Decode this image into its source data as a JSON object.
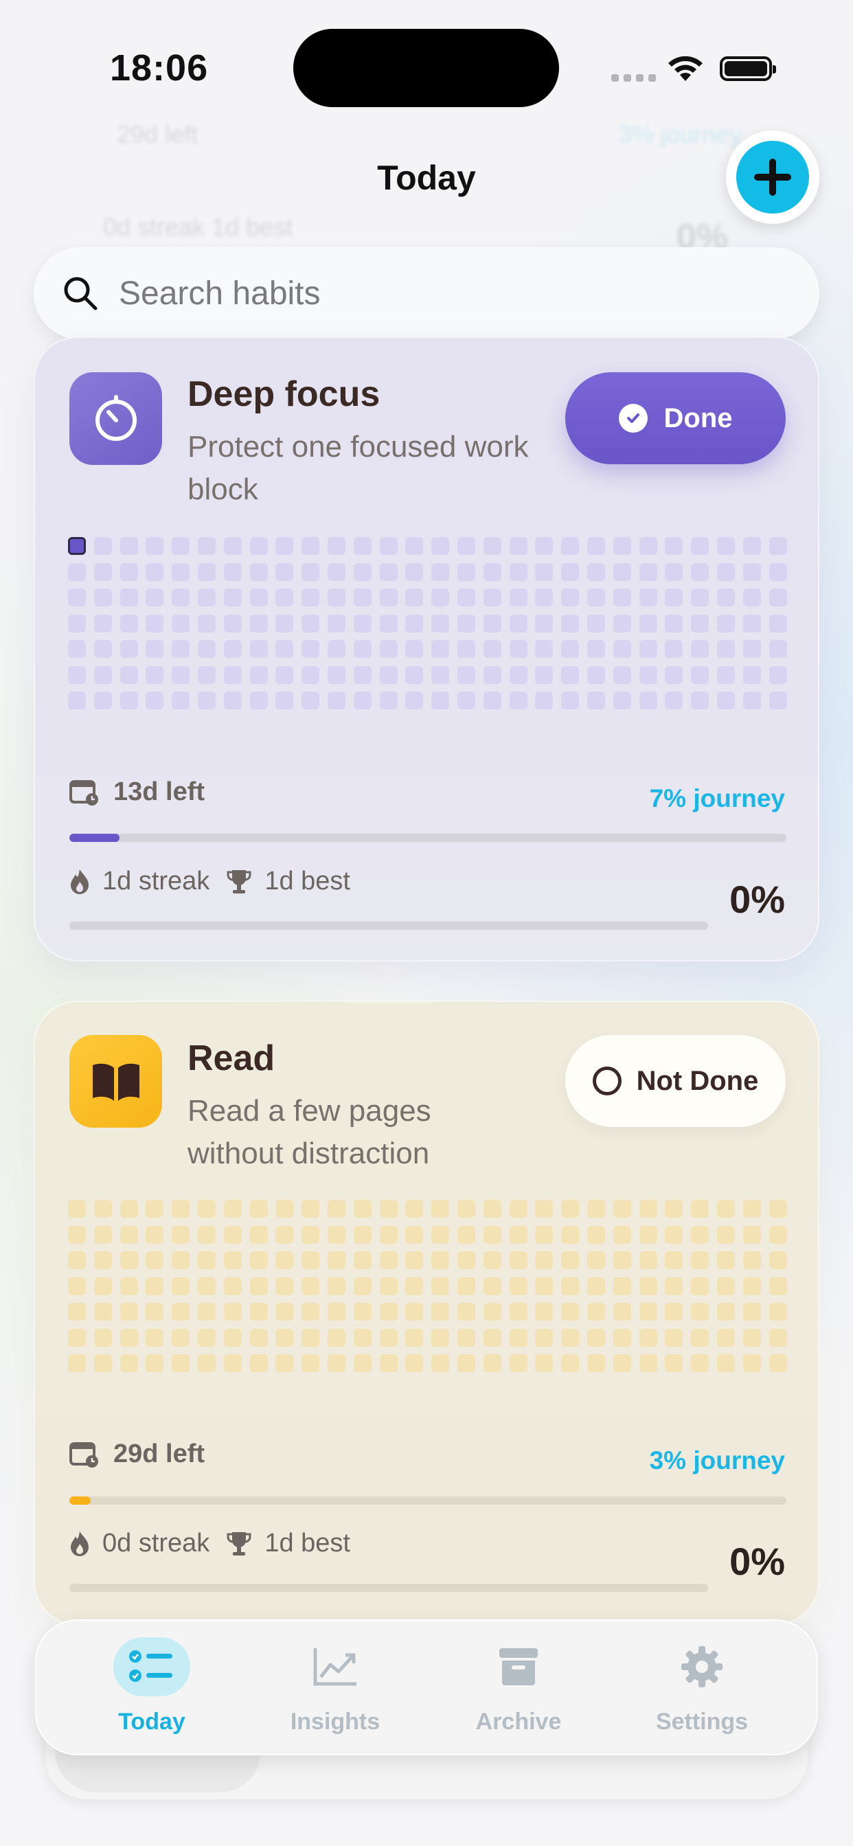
{
  "status_bar": {
    "time": "18:06"
  },
  "header": {
    "title": "Today",
    "add_icon": "plus-icon"
  },
  "background_ghost": {
    "left_text": "29d left",
    "right_text": "3% journey",
    "streak_text": "0d streak   1d best",
    "percent_text": "0%"
  },
  "search": {
    "placeholder": "Search habits",
    "value": ""
  },
  "habits": [
    {
      "title": "Deep focus",
      "description": "Protect one focused work block",
      "icon": "timer-icon",
      "button_label": "Done",
      "button_state": "done",
      "days_left": "13d left",
      "journey": "7% journey",
      "journey_fraction": 0.07,
      "streak": "1d streak",
      "best": "1d best",
      "percent": "0%",
      "completion_fraction": 0.0,
      "completed_days": 1,
      "accent": "#6a55c9"
    },
    {
      "title": "Read",
      "description": "Read a few pages without distraction",
      "icon": "book-icon",
      "button_label": "Not Done",
      "button_state": "not-done",
      "days_left": "29d left",
      "journey": "3% journey",
      "journey_fraction": 0.03,
      "streak": "0d streak",
      "best": "1d best",
      "percent": "0%",
      "completion_fraction": 0.0,
      "completed_days": 0,
      "accent": "#f7b21a"
    }
  ],
  "tabbar": {
    "items": [
      {
        "label": "Today",
        "icon": "checklist-icon",
        "active": true
      },
      {
        "label": "Insights",
        "icon": "chart-icon",
        "active": false
      },
      {
        "label": "Archive",
        "icon": "archive-box-icon",
        "active": false
      },
      {
        "label": "Settings",
        "icon": "gear-icon",
        "active": false
      }
    ]
  },
  "colors": {
    "accent_cyan": "#19b6e6",
    "purple": "#6a55c9",
    "yellow": "#f7b21a"
  }
}
